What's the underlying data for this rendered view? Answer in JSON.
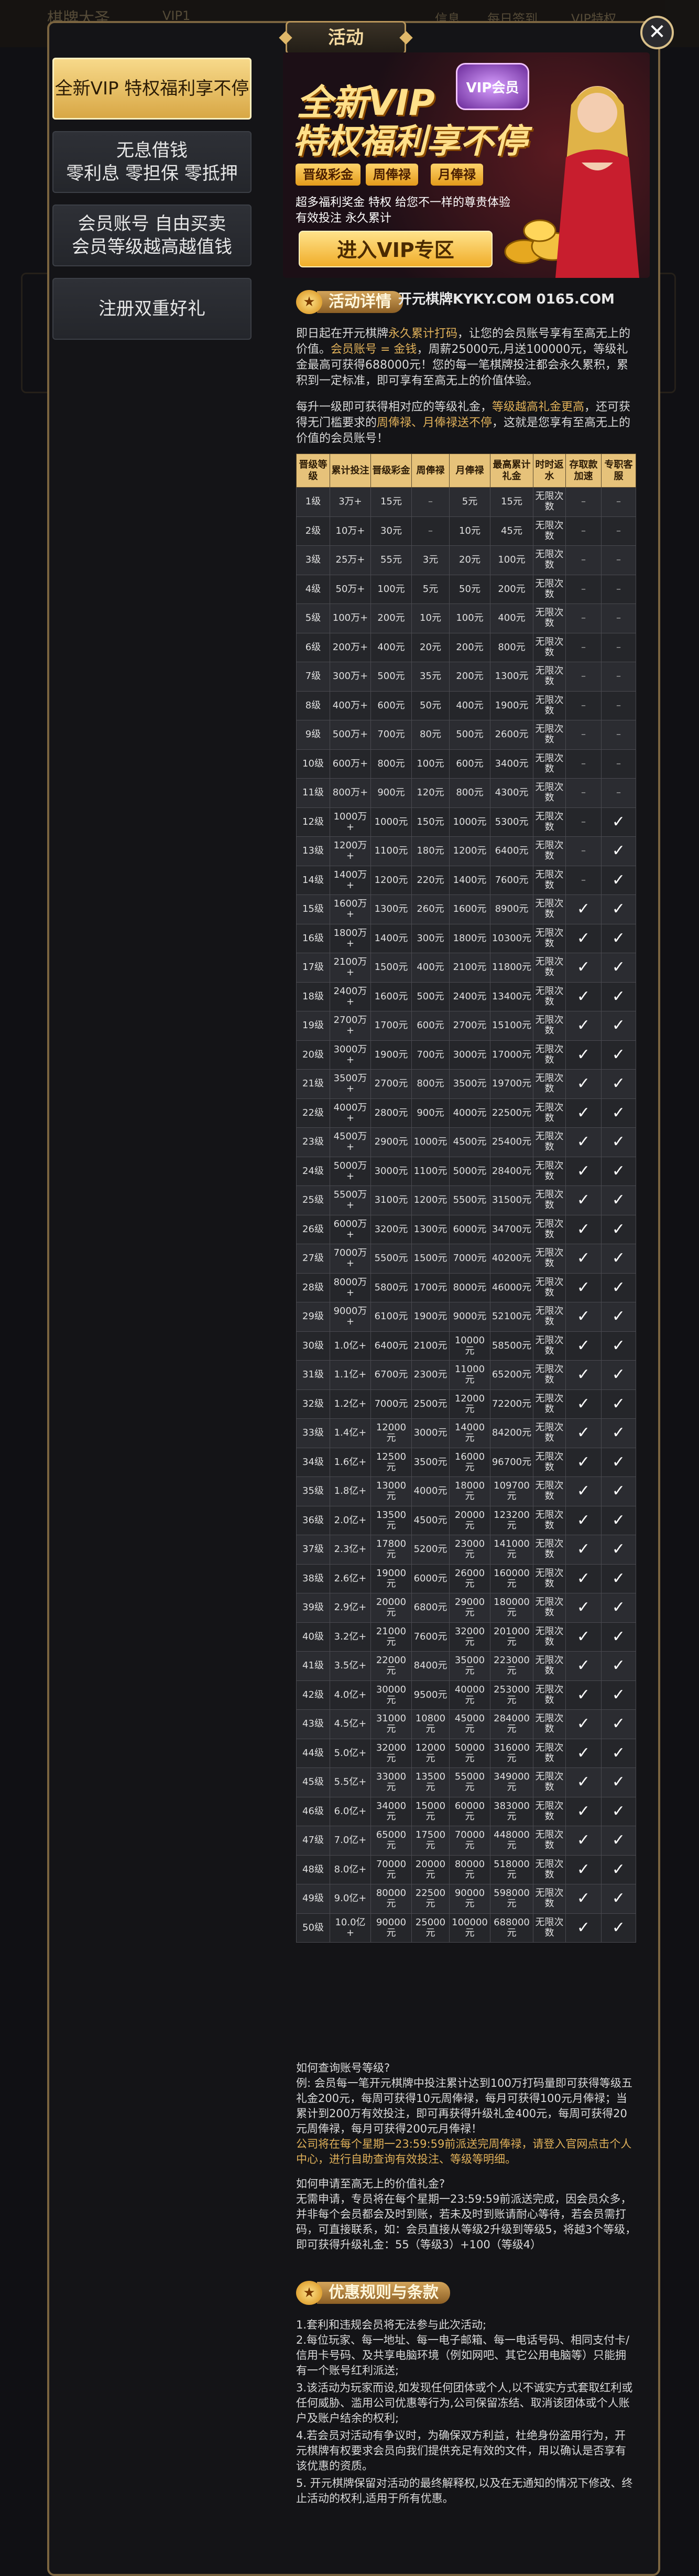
{
  "background": {
    "items": [
      "棋牌大圣",
      "VIP1",
      "信息",
      "每日签到",
      "VIP特权"
    ]
  },
  "modal": {
    "title": "活动",
    "close_label": "✕"
  },
  "sidebar": {
    "items": [
      {
        "label": "全新VIP 特权福利享不停",
        "active": true
      },
      {
        "label": "无息借钱\n零利息 零担保 零抵押",
        "active": false
      },
      {
        "label": "会员账号 自由买卖\n会员等级越高越值钱",
        "active": false
      },
      {
        "label": "注册双重好礼",
        "active": false
      }
    ]
  },
  "banner": {
    "title1": "全新VIP",
    "title2": "特权福利享不停",
    "vip_badge": "VIP会员",
    "pills": [
      "晋级彩金",
      "周俸禄",
      "月俸禄"
    ],
    "desc1": "超多福利奖金  特权  给您不一样的尊贵体验",
    "desc2": "有效投注 永久累计",
    "enter_button": "进入VIP专区"
  },
  "details": {
    "header": "活动详情",
    "site": "开元棋牌KYKY.COM  0165.COM",
    "p1_a": "即日起在开元棋牌",
    "p1_b": "永久累计打码",
    "p1_c": "，让您的会员账号享有至高无上的价值。",
    "p1_d": "会员账号 = 金钱",
    "p1_e": "，周薪25000元,月送100000元，等级礼金最高可获得688000元！您的每一笔棋牌投注都会永久累积，累积到一定标准，即可享有至高无上的价值体验。",
    "p2_a": "每升一级即可获得相对应的等级礼金，",
    "p2_b": "等级越高礼金更高",
    "p2_c": "，还可获得无门槛要求的",
    "p2_d": "周俸禄、月俸禄送不停",
    "p2_e": "，这就是您享有至高无上的价值的会员账号！"
  },
  "table": {
    "headers": [
      "晋级等级",
      "累计投注",
      "晋级彩金",
      "周俸禄",
      "月俸禄",
      "最高累计礼金",
      "时时返水",
      "存取款加速",
      "专职客服"
    ],
    "rows": [
      [
        "1级",
        "3万+",
        "15元",
        "–",
        "5元",
        "15元",
        "无限次数",
        "–",
        "–"
      ],
      [
        "2级",
        "10万+",
        "30元",
        "–",
        "10元",
        "45元",
        "无限次数",
        "–",
        "–"
      ],
      [
        "3级",
        "25万+",
        "55元",
        "3元",
        "20元",
        "100元",
        "无限次数",
        "–",
        "–"
      ],
      [
        "4级",
        "50万+",
        "100元",
        "5元",
        "50元",
        "200元",
        "无限次数",
        "–",
        "–"
      ],
      [
        "5级",
        "100万+",
        "200元",
        "10元",
        "100元",
        "400元",
        "无限次数",
        "–",
        "–"
      ],
      [
        "6级",
        "200万+",
        "400元",
        "20元",
        "200元",
        "800元",
        "无限次数",
        "–",
        "–"
      ],
      [
        "7级",
        "300万+",
        "500元",
        "35元",
        "200元",
        "1300元",
        "无限次数",
        "–",
        "–"
      ],
      [
        "8级",
        "400万+",
        "600元",
        "50元",
        "400元",
        "1900元",
        "无限次数",
        "–",
        "–"
      ],
      [
        "9级",
        "500万+",
        "700元",
        "80元",
        "500元",
        "2600元",
        "无限次数",
        "–",
        "–"
      ],
      [
        "10级",
        "600万+",
        "800元",
        "100元",
        "600元",
        "3400元",
        "无限次数",
        "–",
        "–"
      ],
      [
        "11级",
        "800万+",
        "900元",
        "120元",
        "800元",
        "4300元",
        "无限次数",
        "–",
        "–"
      ],
      [
        "12级",
        "1000万+",
        "1000元",
        "150元",
        "1000元",
        "5300元",
        "无限次数",
        "–",
        "✓"
      ],
      [
        "13级",
        "1200万+",
        "1100元",
        "180元",
        "1200元",
        "6400元",
        "无限次数",
        "–",
        "✓"
      ],
      [
        "14级",
        "1400万+",
        "1200元",
        "220元",
        "1400元",
        "7600元",
        "无限次数",
        "–",
        "✓"
      ],
      [
        "15级",
        "1600万+",
        "1300元",
        "260元",
        "1600元",
        "8900元",
        "无限次数",
        "✓",
        "✓"
      ],
      [
        "16级",
        "1800万+",
        "1400元",
        "300元",
        "1800元",
        "10300元",
        "无限次数",
        "✓",
        "✓"
      ],
      [
        "17级",
        "2100万+",
        "1500元",
        "400元",
        "2100元",
        "11800元",
        "无限次数",
        "✓",
        "✓"
      ],
      [
        "18级",
        "2400万+",
        "1600元",
        "500元",
        "2400元",
        "13400元",
        "无限次数",
        "✓",
        "✓"
      ],
      [
        "19级",
        "2700万+",
        "1700元",
        "600元",
        "2700元",
        "15100元",
        "无限次数",
        "✓",
        "✓"
      ],
      [
        "20级",
        "3000万+",
        "1900元",
        "700元",
        "3000元",
        "17000元",
        "无限次数",
        "✓",
        "✓"
      ],
      [
        "21级",
        "3500万+",
        "2700元",
        "800元",
        "3500元",
        "19700元",
        "无限次数",
        "✓",
        "✓"
      ],
      [
        "22级",
        "4000万+",
        "2800元",
        "900元",
        "4000元",
        "22500元",
        "无限次数",
        "✓",
        "✓"
      ],
      [
        "23级",
        "4500万+",
        "2900元",
        "1000元",
        "4500元",
        "25400元",
        "无限次数",
        "✓",
        "✓"
      ],
      [
        "24级",
        "5000万+",
        "3000元",
        "1100元",
        "5000元",
        "28400元",
        "无限次数",
        "✓",
        "✓"
      ],
      [
        "25级",
        "5500万+",
        "3100元",
        "1200元",
        "5500元",
        "31500元",
        "无限次数",
        "✓",
        "✓"
      ],
      [
        "26级",
        "6000万+",
        "3200元",
        "1300元",
        "6000元",
        "34700元",
        "无限次数",
        "✓",
        "✓"
      ],
      [
        "27级",
        "7000万+",
        "5500元",
        "1500元",
        "7000元",
        "40200元",
        "无限次数",
        "✓",
        "✓"
      ],
      [
        "28级",
        "8000万+",
        "5800元",
        "1700元",
        "8000元",
        "46000元",
        "无限次数",
        "✓",
        "✓"
      ],
      [
        "29级",
        "9000万+",
        "6100元",
        "1900元",
        "9000元",
        "52100元",
        "无限次数",
        "✓",
        "✓"
      ],
      [
        "30级",
        "1.0亿+",
        "6400元",
        "2100元",
        "10000元",
        "58500元",
        "无限次数",
        "✓",
        "✓"
      ],
      [
        "31级",
        "1.1亿+",
        "6700元",
        "2300元",
        "11000元",
        "65200元",
        "无限次数",
        "✓",
        "✓"
      ],
      [
        "32级",
        "1.2亿+",
        "7000元",
        "2500元",
        "12000元",
        "72200元",
        "无限次数",
        "✓",
        "✓"
      ],
      [
        "33级",
        "1.4亿+",
        "12000元",
        "3000元",
        "14000元",
        "84200元",
        "无限次数",
        "✓",
        "✓"
      ],
      [
        "34级",
        "1.6亿+",
        "12500元",
        "3500元",
        "16000元",
        "96700元",
        "无限次数",
        "✓",
        "✓"
      ],
      [
        "35级",
        "1.8亿+",
        "13000元",
        "4000元",
        "18000元",
        "109700元",
        "无限次数",
        "✓",
        "✓"
      ],
      [
        "36级",
        "2.0亿+",
        "13500元",
        "4500元",
        "20000元",
        "123200元",
        "无限次数",
        "✓",
        "✓"
      ],
      [
        "37级",
        "2.3亿+",
        "17800元",
        "5200元",
        "23000元",
        "141000元",
        "无限次数",
        "✓",
        "✓"
      ],
      [
        "38级",
        "2.6亿+",
        "19000元",
        "6000元",
        "26000元",
        "160000元",
        "无限次数",
        "✓",
        "✓"
      ],
      [
        "39级",
        "2.9亿+",
        "20000元",
        "6800元",
        "29000元",
        "180000元",
        "无限次数",
        "✓",
        "✓"
      ],
      [
        "40级",
        "3.2亿+",
        "21000元",
        "7600元",
        "32000元",
        "201000元",
        "无限次数",
        "✓",
        "✓"
      ],
      [
        "41级",
        "3.5亿+",
        "22000元",
        "8400元",
        "35000元",
        "223000元",
        "无限次数",
        "✓",
        "✓"
      ],
      [
        "42级",
        "4.0亿+",
        "30000元",
        "9500元",
        "40000元",
        "253000元",
        "无限次数",
        "✓",
        "✓"
      ],
      [
        "43级",
        "4.5亿+",
        "31000元",
        "10800元",
        "45000元",
        "284000元",
        "无限次数",
        "✓",
        "✓"
      ],
      [
        "44级",
        "5.0亿+",
        "32000元",
        "12000元",
        "50000元",
        "316000元",
        "无限次数",
        "✓",
        "✓"
      ],
      [
        "45级",
        "5.5亿+",
        "33000元",
        "13500元",
        "55000元",
        "349000元",
        "无限次数",
        "✓",
        "✓"
      ],
      [
        "46级",
        "6.0亿+",
        "34000元",
        "15000元",
        "60000元",
        "383000元",
        "无限次数",
        "✓",
        "✓"
      ],
      [
        "47级",
        "7.0亿+",
        "65000元",
        "17500元",
        "70000元",
        "448000元",
        "无限次数",
        "✓",
        "✓"
      ],
      [
        "48级",
        "8.0亿+",
        "70000元",
        "20000元",
        "80000元",
        "518000元",
        "无限次数",
        "✓",
        "✓"
      ],
      [
        "49级",
        "9.0亿+",
        "80000元",
        "22500元",
        "90000元",
        "598000元",
        "无限次数",
        "✓",
        "✓"
      ],
      [
        "50级",
        "10.0亿+",
        "90000元",
        "25000元",
        "100000元",
        "688000元",
        "无限次数",
        "✓",
        "✓"
      ]
    ]
  },
  "faq": {
    "q1": "如何查询账号等级?",
    "a1": "例: 会员每一笔开元棋牌中投注累计达到100万打码量即可获得等级五礼金200元，每周可获得10元周俸禄，每月可获得100元月俸禄；当累计到200万有效投注，即可再获得升级礼金400元，每周可获得20元周俸禄，每月可获得200元月俸禄！",
    "a1_hl": "公司将在每个星期一23:59:59前派送完周俸禄，请登入官网点击个人中心，进行自助查询有效投注、等级等明细。",
    "q2": "如何申请至高无上的价值礼金?",
    "a2": "无需申请，专员将在每个星期一23:59:59前派送完成，因会员众多，并非每个会员都会及时到账，若未及时到账请耐心等待，若会员需打码，可直接联系，如：会员直接从等级2升级到等级5，将越3个等级，即可获得升级礼金：55（等级3）+100（等级4）"
  },
  "rules": {
    "header": "优惠规则与条款",
    "items": [
      "1.套利和违规会员将无法参与此次活动;",
      "2.每位玩家、每一地址、每一电子邮箱、每一电话号码、相同支付卡/信用卡号码、及共享电脑环境（例如网吧、其它公用电脑等）只能拥有一个账号红利派送;",
      "3.该活动为玩家而设,如发现任何团体或个人,以不诚实方式套取红利或任何威胁、滥用公司优惠等行为,公司保留冻结、取消该团体或个人账户及账户结余的权利;",
      "4.若会员对活动有争议时，为确保双方利益，杜绝身份盗用行为，开元棋牌有权要求会员向我们提供充足有效的文件，用以确认是否享有该优惠的资质。",
      "5. 开元棋牌保留对活动的最终解释权,以及在无通知的情况下修改、终止活动的权利,适用于所有优惠。"
    ]
  },
  "colors": {
    "accent": "#e0b15a",
    "gold": "#e6c27a",
    "frame": "#7a6440"
  }
}
